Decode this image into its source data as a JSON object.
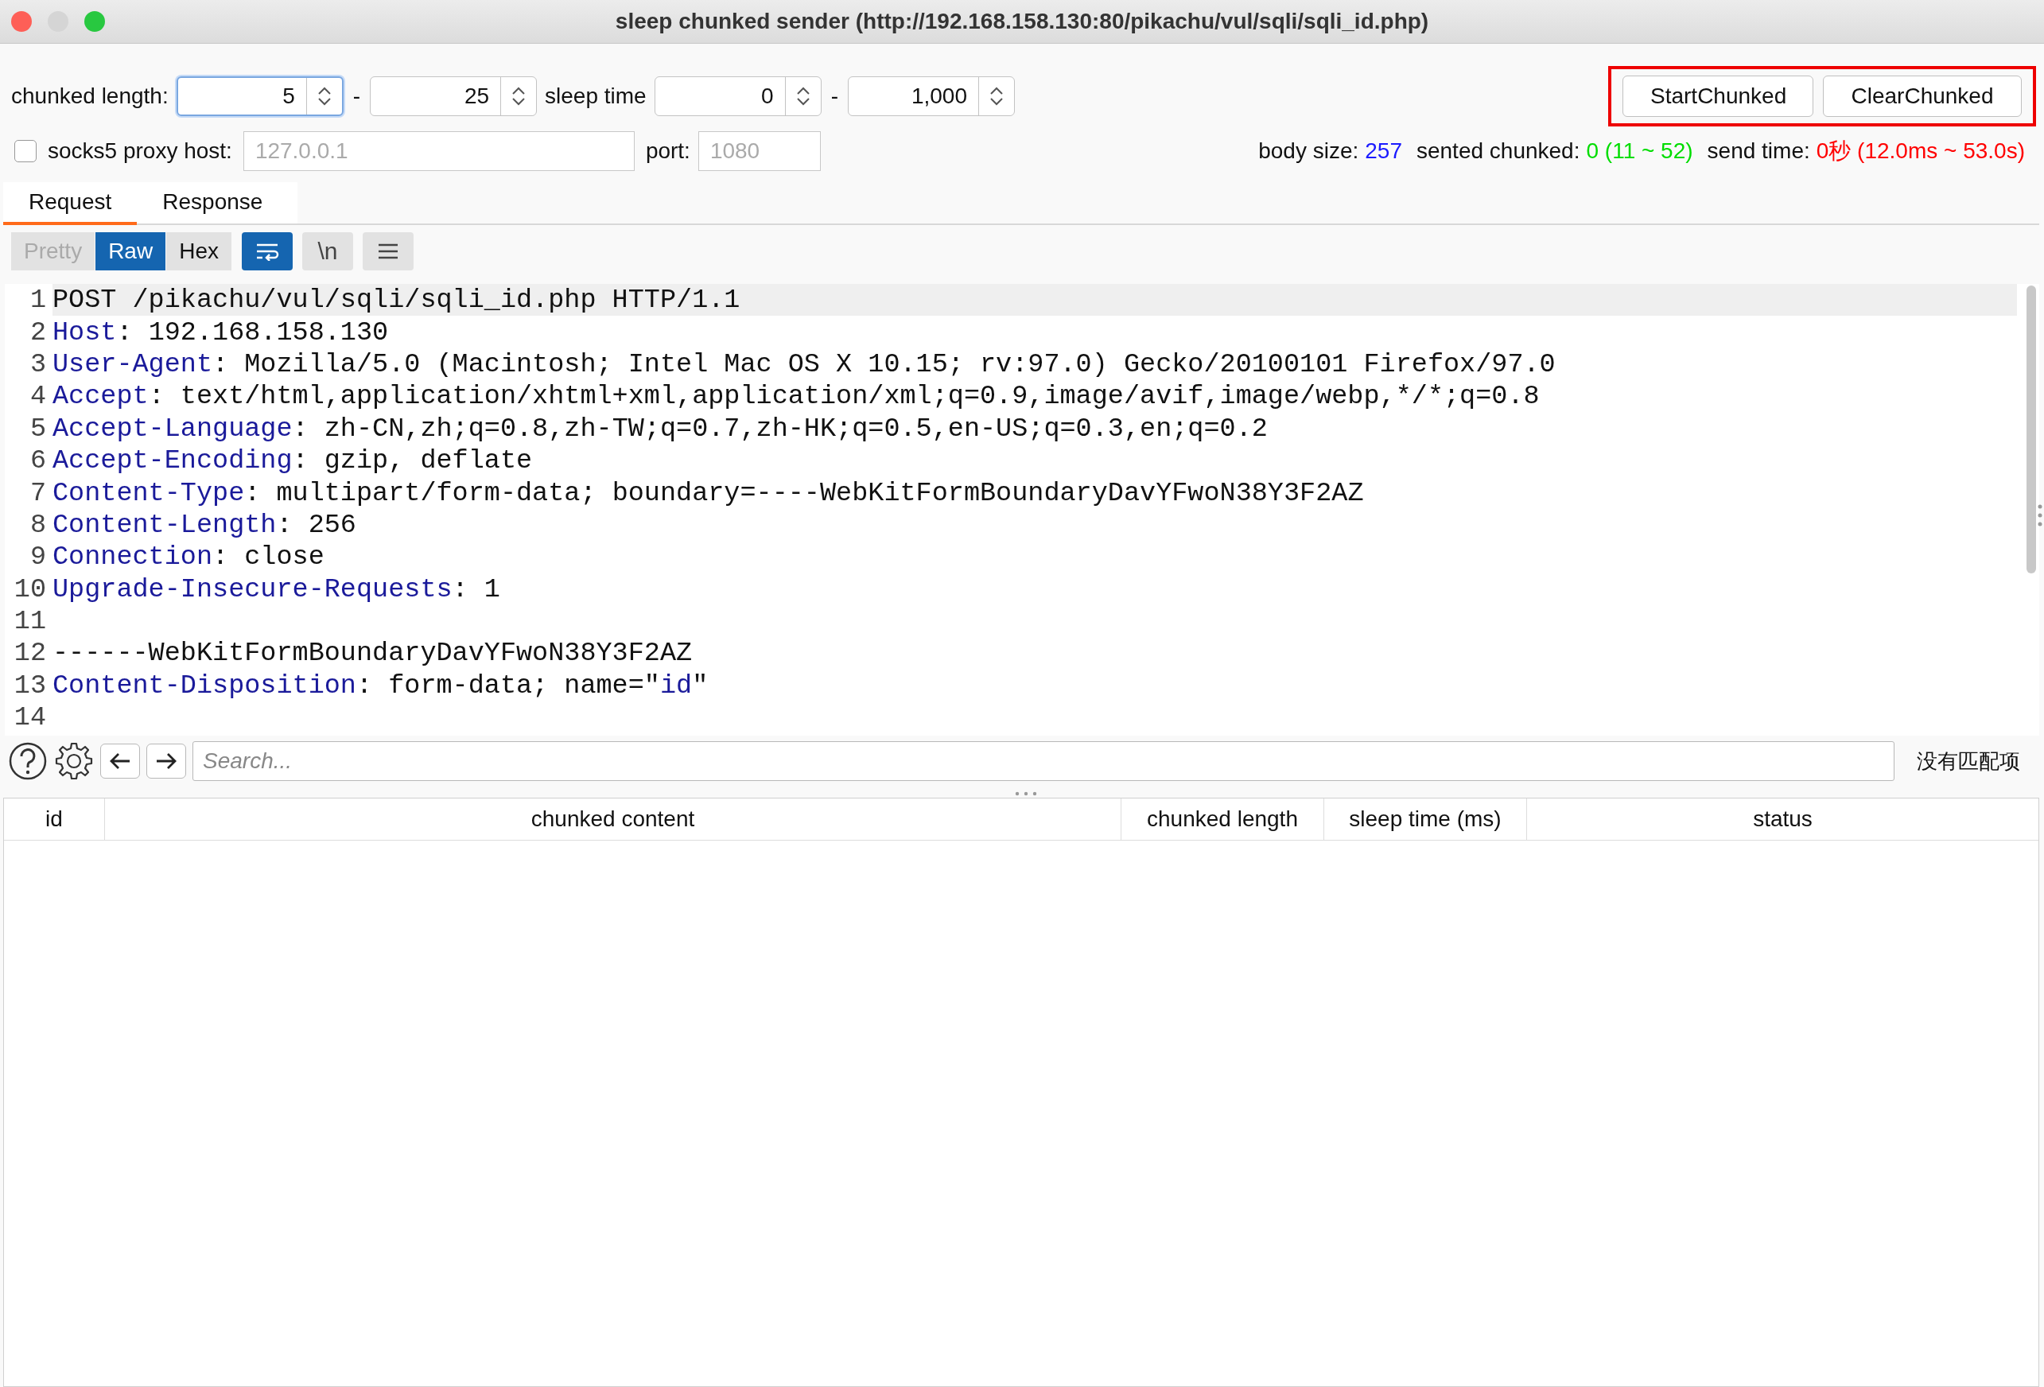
{
  "window": {
    "title": "sleep chunked sender (http://192.168.158.130:80/pikachu/vul/sqli/sqli_id.php)"
  },
  "settings": {
    "chunked_label": "chunked length:",
    "chunked_min": "5",
    "chunked_max": "25",
    "sleep_label": "sleep time",
    "sleep_min": "0",
    "sleep_max": "1,000",
    "separator": "-"
  },
  "actions": [
    {
      "label": "StartChunked"
    },
    {
      "label": "ClearChunked"
    }
  ],
  "proxy": {
    "checked": false,
    "host_label": "socks5 proxy host:",
    "host_placeholder": "127.0.0.1",
    "port_label": "port:",
    "port_placeholder": "1080"
  },
  "stats": [
    {
      "label": "body size:",
      "value": "257",
      "color": "#1a1aff"
    },
    {
      "label": "sented chunked:",
      "value": "0 (11 ~ 52)",
      "color": "#00dd00"
    },
    {
      "label": "send time:",
      "value": "0秒 (12.0ms ~ 53.0s)",
      "color": "#ff0000"
    }
  ],
  "tabs": [
    {
      "label": "Request",
      "selected": true
    },
    {
      "label": "Response",
      "selected": false
    }
  ],
  "view_modes": [
    {
      "label": "Pretty",
      "selected": false,
      "disabled": true
    },
    {
      "label": "Raw",
      "selected": true,
      "disabled": false
    },
    {
      "label": "Hex",
      "selected": false,
      "disabled": false
    }
  ],
  "view_toggles": [
    {
      "kind": "wrap",
      "on": true
    },
    {
      "kind": "newline",
      "label": "\\n",
      "on": false
    },
    {
      "kind": "menu",
      "on": false
    }
  ],
  "editor": {
    "lines": [
      {
        "number": "1",
        "current": true,
        "segments": [
          {
            "kind": "plain",
            "text": "POST /pikachu/vul/sqli/sqli_id.php HTTP/1.1"
          }
        ]
      },
      {
        "number": "2",
        "current": false,
        "segments": [
          {
            "kind": "key",
            "text": "Host"
          },
          {
            "kind": "plain",
            "text": ": 192.168.158.130"
          }
        ]
      },
      {
        "number": "3",
        "current": false,
        "segments": [
          {
            "kind": "key",
            "text": "User-Agent"
          },
          {
            "kind": "plain",
            "text": ": Mozilla/5.0 (Macintosh; Intel Mac OS X 10.15; rv:97.0) Gecko/20100101 Firefox/97.0"
          }
        ]
      },
      {
        "number": "4",
        "current": false,
        "segments": [
          {
            "kind": "key",
            "text": "Accept"
          },
          {
            "kind": "plain",
            "text": ": text/html,application/xhtml+xml,application/xml;q=0.9,image/avif,image/webp,*/*;q=0.8"
          }
        ]
      },
      {
        "number": "5",
        "current": false,
        "segments": [
          {
            "kind": "key",
            "text": "Accept-Language"
          },
          {
            "kind": "plain",
            "text": ": zh-CN,zh;q=0.8,zh-TW;q=0.7,zh-HK;q=0.5,en-US;q=0.3,en;q=0.2"
          }
        ]
      },
      {
        "number": "6",
        "current": false,
        "segments": [
          {
            "kind": "key",
            "text": "Accept-Encoding"
          },
          {
            "kind": "plain",
            "text": ": gzip, deflate"
          }
        ]
      },
      {
        "number": "7",
        "current": false,
        "segments": [
          {
            "kind": "key",
            "text": "Content-Type"
          },
          {
            "kind": "plain",
            "text": ": multipart/form-data; boundary=----WebKitFormBoundaryDavYFwoN38Y3F2AZ"
          }
        ]
      },
      {
        "number": "8",
        "current": false,
        "segments": [
          {
            "kind": "key",
            "text": "Content-Length"
          },
          {
            "kind": "plain",
            "text": ": 256"
          }
        ]
      },
      {
        "number": "9",
        "current": false,
        "segments": [
          {
            "kind": "key",
            "text": "Connection"
          },
          {
            "kind": "plain",
            "text": ": close"
          }
        ]
      },
      {
        "number": "10",
        "current": false,
        "segments": [
          {
            "kind": "key",
            "text": "Upgrade-Insecure-Requests"
          },
          {
            "kind": "plain",
            "text": ": 1"
          }
        ]
      },
      {
        "number": "11",
        "current": false
      },
      {
        "number": "12",
        "current": false,
        "segments": [
          {
            "kind": "plain",
            "text": "------WebKitFormBoundaryDavYFwoN38Y3F2AZ"
          }
        ]
      },
      {
        "number": "13",
        "current": false,
        "segments": [
          {
            "kind": "key",
            "text": "Content-Disposition"
          },
          {
            "kind": "plain",
            "text": ": form-data; name=\""
          },
          {
            "kind": "key",
            "text": "id"
          },
          {
            "kind": "plain",
            "text": "\""
          }
        ]
      },
      {
        "number": "14",
        "current": false
      }
    ]
  },
  "search": {
    "placeholder": "Search...",
    "result": "没有匹配项"
  },
  "table": {
    "columns": [
      "id",
      "chunked content",
      "chunked length",
      "sleep time (ms)",
      "status"
    ]
  }
}
